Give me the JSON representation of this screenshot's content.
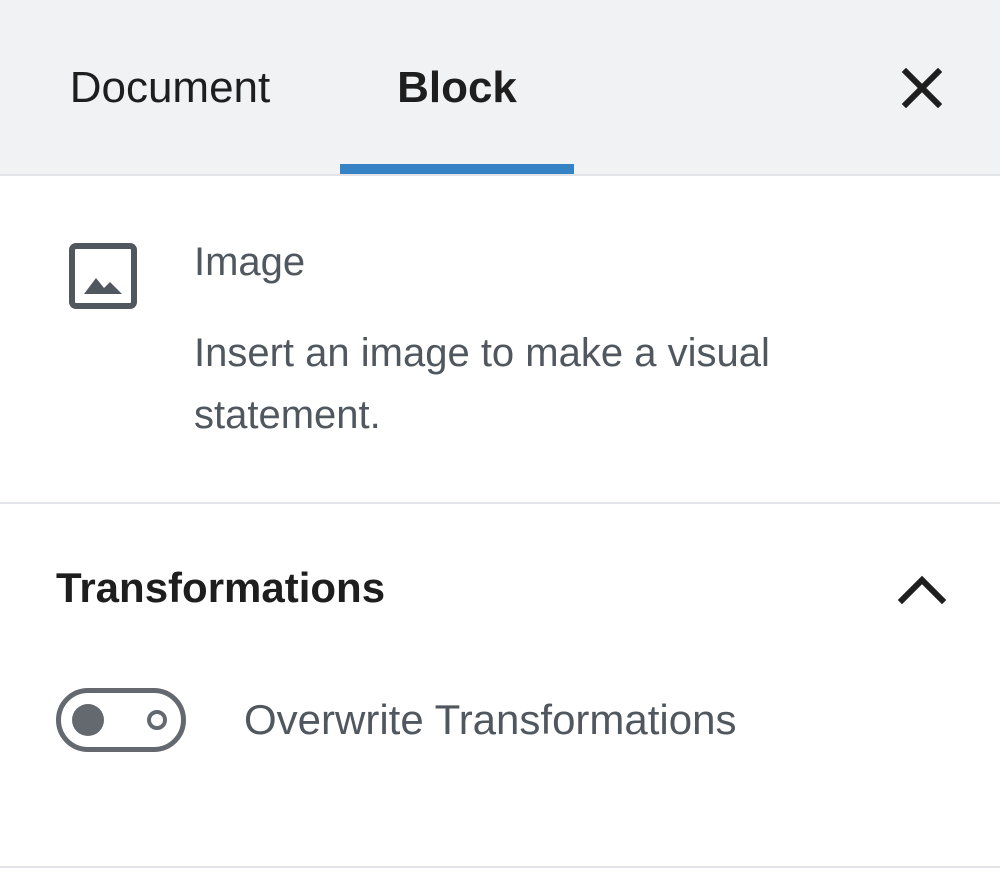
{
  "tabs": [
    {
      "label": "Document",
      "active": false
    },
    {
      "label": "Block",
      "active": true
    }
  ],
  "close_icon": "close-icon",
  "block": {
    "icon": "image-icon",
    "title": "Image",
    "description": "Insert an image to make a visual statement."
  },
  "transformations": {
    "title": "Transformations",
    "expanded": true,
    "chevron_icon": "chevron-up-icon",
    "toggle": {
      "label": "Overwrite Transformations",
      "checked": false
    }
  },
  "colors": {
    "accent": "#3582c4",
    "header_bg": "#f1f2f4",
    "text_dark": "#1e1e1e",
    "text_muted": "#50575e",
    "toggle_gray": "#646970"
  }
}
